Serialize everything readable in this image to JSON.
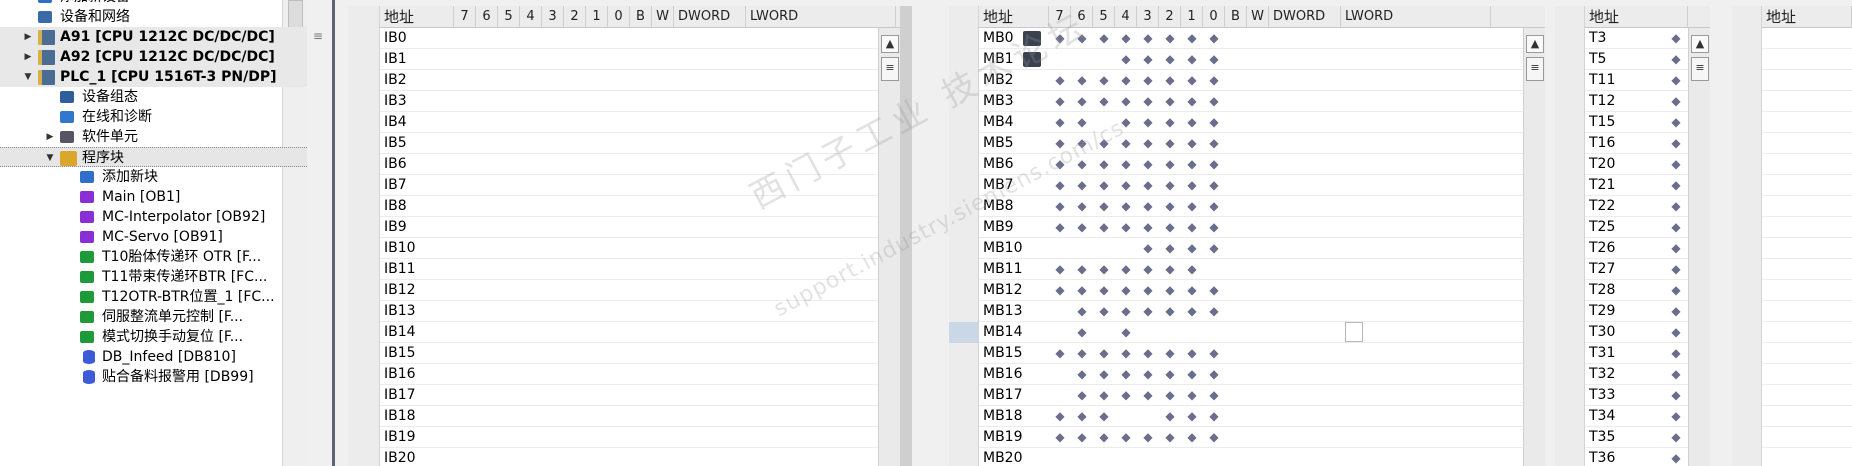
{
  "tree": {
    "items": [
      {
        "label": "添加新设备",
        "icon": "add-device-icon",
        "arrow": "",
        "indent": 1,
        "kind": "plain"
      },
      {
        "label": "设备和网络",
        "icon": "network-icon",
        "arrow": "",
        "indent": 1,
        "kind": "plain"
      },
      {
        "label": "A91 [CPU 1212C DC/DC/DC]",
        "icon": "plc-icon",
        "arrow": "▶",
        "indent": 1,
        "kind": "dev"
      },
      {
        "label": "A92 [CPU 1212C DC/DC/DC]",
        "icon": "plc-icon",
        "arrow": "▶",
        "indent": 1,
        "kind": "dev"
      },
      {
        "label": "PLC_1 [CPU 1516T-3 PN/DP]",
        "icon": "plc-icon",
        "arrow": "▼",
        "indent": 1,
        "kind": "dev"
      },
      {
        "label": "设备组态",
        "icon": "device-config-icon",
        "arrow": "",
        "indent": 2,
        "kind": "plain"
      },
      {
        "label": "在线和诊断",
        "icon": "diagnostics-icon",
        "arrow": "",
        "indent": 2,
        "kind": "plain"
      },
      {
        "label": "软件单元",
        "icon": "software-unit-icon",
        "arrow": "▶",
        "indent": 2,
        "kind": "plain"
      },
      {
        "label": "程序块",
        "icon": "folder-icon",
        "arrow": "▼",
        "indent": 2,
        "kind": "sel"
      },
      {
        "label": "添加新块",
        "icon": "add-block-icon",
        "arrow": "",
        "indent": 3,
        "kind": "plain"
      },
      {
        "label": "Main [OB1]",
        "icon": "ob-block-icon",
        "arrow": "",
        "indent": 3,
        "kind": "plain"
      },
      {
        "label": "MC-Interpolator [OB92]",
        "icon": "ob-block-icon",
        "arrow": "",
        "indent": 3,
        "kind": "plain"
      },
      {
        "label": "MC-Servo [OB91]",
        "icon": "ob-block-icon",
        "arrow": "",
        "indent": 3,
        "kind": "plain"
      },
      {
        "label": "T10胎体传递环 OTR [F...",
        "icon": "fc-block-icon",
        "arrow": "",
        "indent": 3,
        "kind": "plain"
      },
      {
        "label": "T11带束传递环BTR [FC...",
        "icon": "fc-block-icon",
        "arrow": "",
        "indent": 3,
        "kind": "plain"
      },
      {
        "label": "T12OTR-BTR位置_1 [FC...",
        "icon": "fc-block-icon",
        "arrow": "",
        "indent": 3,
        "kind": "plain"
      },
      {
        "label": "伺服整流单元控制 [F...",
        "icon": "fc-block-icon",
        "arrow": "",
        "indent": 3,
        "kind": "plain"
      },
      {
        "label": "模式切换手动复位 [F...",
        "icon": "fc-block-icon",
        "arrow": "",
        "indent": 3,
        "kind": "plain"
      },
      {
        "label": "DB_Infeed [DB810]",
        "icon": "db-block-icon",
        "arrow": "",
        "indent": 3,
        "kind": "plain"
      },
      {
        "label": "贴合备料报警用 [DB99]",
        "icon": "db-block-icon",
        "arrow": "",
        "indent": 3,
        "kind": "plain"
      }
    ]
  },
  "headers": {
    "addr": "地址",
    "bits": [
      "7",
      "6",
      "5",
      "4",
      "3",
      "2",
      "1",
      "0",
      "B",
      "W"
    ],
    "dword": "DWORD",
    "lword": "LWORD"
  },
  "input_table": {
    "addresses": [
      "IB0",
      "IB1",
      "IB2",
      "IB3",
      "IB4",
      "IB5",
      "IB6",
      "IB7",
      "IB8",
      "IB9",
      "IB10",
      "IB11",
      "IB12",
      "IB13",
      "IB14",
      "IB15",
      "IB16",
      "IB17",
      "IB18",
      "IB19",
      "IB20"
    ]
  },
  "marker_table": {
    "rows": [
      {
        "addr": "MB0",
        "bits": "11111111",
        "icon": "clock-memory-icon"
      },
      {
        "addr": "MB1",
        "bits": "00011111",
        "icon": "system-memory-icon"
      },
      {
        "addr": "MB2",
        "bits": "11111111",
        "icon": ""
      },
      {
        "addr": "MB3",
        "bits": "11111111",
        "icon": ""
      },
      {
        "addr": "MB4",
        "bits": "11011111",
        "icon": ""
      },
      {
        "addr": "MB5",
        "bits": "11111111",
        "icon": ""
      },
      {
        "addr": "MB6",
        "bits": "11111111",
        "icon": ""
      },
      {
        "addr": "MB7",
        "bits": "11111111",
        "icon": ""
      },
      {
        "addr": "MB8",
        "bits": "11111111",
        "icon": ""
      },
      {
        "addr": "MB9",
        "bits": "11111111",
        "icon": ""
      },
      {
        "addr": "MB10",
        "bits": "00001111",
        "icon": ""
      },
      {
        "addr": "MB11",
        "bits": "11111110",
        "icon": ""
      },
      {
        "addr": "MB12",
        "bits": "11111111",
        "icon": ""
      },
      {
        "addr": "MB13",
        "bits": "01111111",
        "icon": ""
      },
      {
        "addr": "MB14",
        "bits": "01010000",
        "icon": ""
      },
      {
        "addr": "MB15",
        "bits": "11111111",
        "icon": ""
      },
      {
        "addr": "MB16",
        "bits": "01111111",
        "icon": ""
      },
      {
        "addr": "MB17",
        "bits": "01111111",
        "icon": ""
      },
      {
        "addr": "MB18",
        "bits": "11100111",
        "icon": ""
      },
      {
        "addr": "MB19",
        "bits": "11111111",
        "icon": ""
      },
      {
        "addr": "MB20",
        "bits": "00000000",
        "icon": ""
      }
    ]
  },
  "timer_table": {
    "addresses": [
      "T3",
      "T5",
      "T11",
      "T12",
      "T15",
      "T16",
      "T20",
      "T21",
      "T22",
      "T25",
      "T26",
      "T27",
      "T28",
      "T29",
      "T30",
      "T31",
      "T32",
      "T33",
      "T34",
      "T35",
      "T36"
    ]
  },
  "watermark": {
    "line1": "西门子工业 技术论坛",
    "line2": "support.industry.siemens.com/cs"
  },
  "colors": {
    "mark": "#6a6e8c",
    "divider": "#5b6470"
  }
}
